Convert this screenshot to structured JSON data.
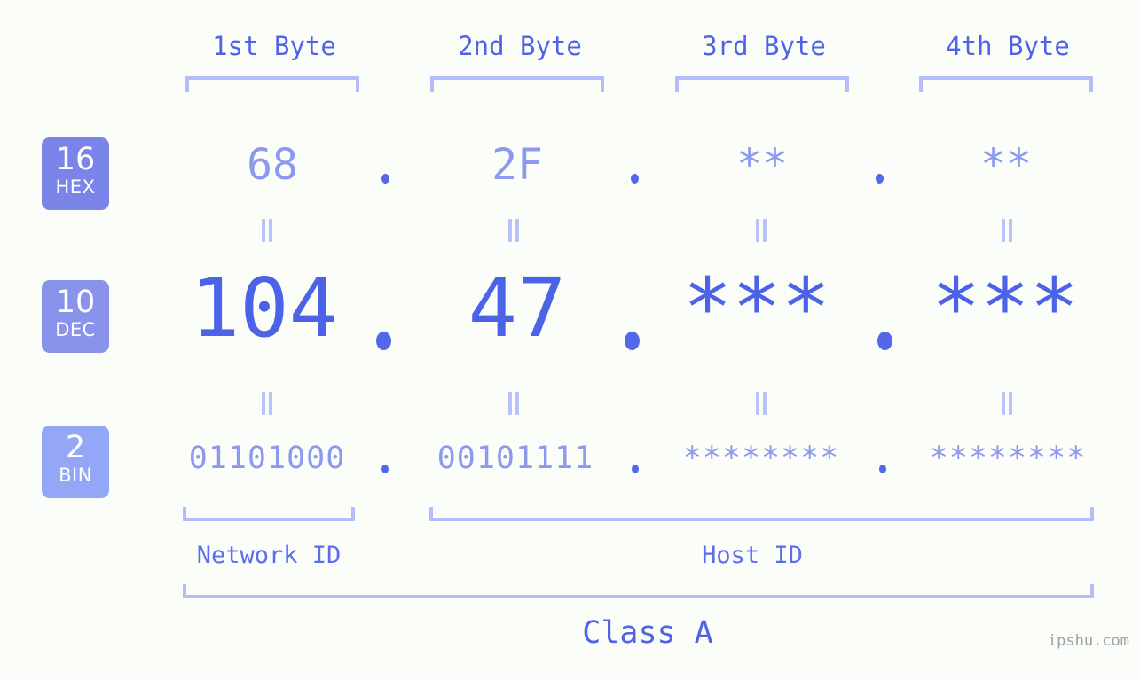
{
  "page": {
    "background_color": "#fafdf8",
    "watermark": "ipshu.com"
  },
  "colors": {
    "accent_strong": "#4d63e7",
    "accent_mid": "#5a6df0",
    "accent_light": "#8d99ef",
    "bracket": "#b3bdfa",
    "equals": "#b9c2f8",
    "dot": "#5466ea",
    "badge_hex": "#7b84e9",
    "badge_dec": "#8a93ec",
    "badge_bin": "#94a6f6",
    "watermark_color": "#9aa0a6"
  },
  "byte_headers": [
    {
      "label": "1st Byte"
    },
    {
      "label": "2nd Byte"
    },
    {
      "label": "3rd Byte"
    },
    {
      "label": "4th Byte"
    }
  ],
  "rows": [
    {
      "id": "hex",
      "badge_number": "16",
      "badge_name": "HEX",
      "badge_color": "#7b84e9",
      "values": [
        "68",
        "2F",
        "**",
        "**"
      ]
    },
    {
      "id": "dec",
      "badge_number": "10",
      "badge_name": "DEC",
      "badge_color": "#8a93ec",
      "values": [
        "104",
        "47",
        "***",
        "***"
      ]
    },
    {
      "id": "bin",
      "badge_number": "2",
      "badge_name": "BIN",
      "badge_color": "#94a6f6",
      "values": [
        "01101000",
        "00101111",
        "********",
        "********"
      ]
    }
  ],
  "separator": ".",
  "equals_sign": "=",
  "id_sections": [
    {
      "label": "Network ID"
    },
    {
      "label": "Host ID"
    }
  ],
  "class_section": {
    "label": "Class A"
  }
}
